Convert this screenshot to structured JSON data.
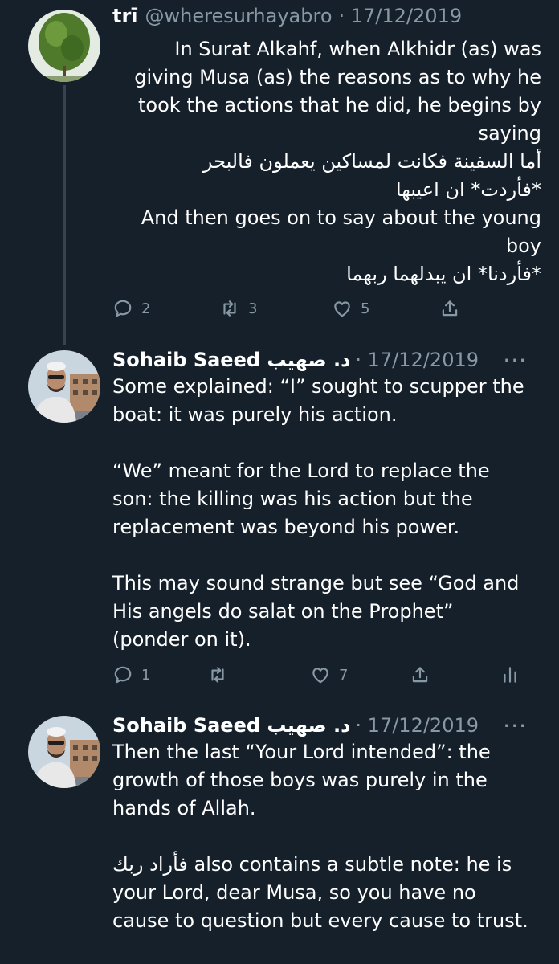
{
  "tweets": [
    {
      "name": "trī",
      "handle": "@wheresurhayabro",
      "date": "· 17/12/2019",
      "lines": [
        "In Surat Alkahf, when Alkhidr (as) was",
        "giving Musa (as) the reasons as to why he",
        "took the actions that he did, he begins by",
        "saying",
        "أما السفينة فكانت لمساكين يعملون فالبحر",
        "*فأردت* ان اعيبها",
        "And then goes on to say about the young",
        "boy",
        "*فأردنا* ان يبدلهما ربهما"
      ],
      "replies": "2",
      "retweets": "3",
      "likes": "5"
    },
    {
      "name": "Sohaib Saeed د. صهيب",
      "date": "· 17/12/2019",
      "more": "···",
      "paragraphs": [
        [
          "Some explained: “I” sought to scupper the",
          "boat: it was purely his action."
        ],
        [
          "“We” meant for the Lord to replace the",
          "son: the killing was his action but the",
          "replacement was beyond his power."
        ],
        [
          "This may sound strange but see “God and",
          "His angels do salat on the Prophet”",
          "(ponder on it)."
        ]
      ],
      "replies": "1",
      "retweets": "",
      "likes": "7"
    },
    {
      "name": "Sohaib Saeed د. صهيب",
      "date": "· 17/12/2019",
      "more": "···",
      "paragraphs": [
        [
          "Then the last “Your Lord intended”: the",
          "growth of those boys was purely in the",
          "hands of Allah."
        ]
      ],
      "last_para": {
        "arabic": "فأراد ربك",
        "first_rest": " also contains a subtle note: he is",
        "line2": "your Lord, dear Musa, so you have no",
        "line3": "cause to question but every cause to trust."
      }
    }
  ],
  "icons": [
    "reply-icon",
    "retweet-icon",
    "like-icon",
    "share-icon",
    "analytics-icon"
  ],
  "colors": {
    "background": "#15202b",
    "muted": "#8899a6",
    "thread_line": "#38444d"
  }
}
